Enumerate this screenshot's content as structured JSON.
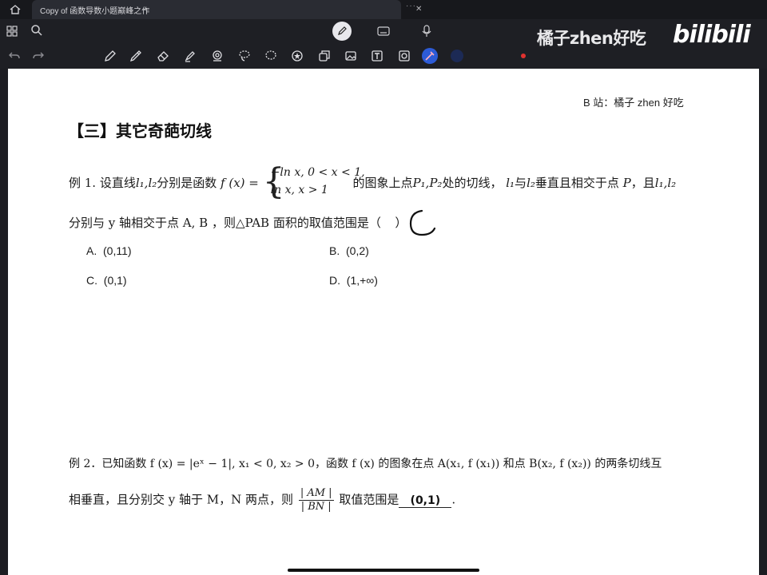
{
  "tab": {
    "title": "Copy of 函数导数小题巅峰之作"
  },
  "watermark": {
    "text": "橘子zhen好吃",
    "logo": "bilibili"
  },
  "toolbar": {
    "tools": [
      "pen-icon",
      "pencil-icon",
      "eraser-icon",
      "highlighter-icon",
      "shape-icon",
      "lasso-icon",
      "lasso-select-icon",
      "sticker-icon",
      "copy-icon",
      "image-icon",
      "text-icon",
      "camera-icon",
      "laser-icon"
    ],
    "colors": {
      "blue": "#2d5bd6",
      "dark": "#1c2a55",
      "red": "#e0322f"
    }
  },
  "page": {
    "credit": "B 站：橘子 zhen 好吃",
    "section_title": "【三】其它奇葩切线",
    "q1": {
      "line1_prefix": "例 1. 设直线",
      "line1_l": "l₁,l₂",
      "line1_mid": "分别是函数",
      "line1_fx": "f (x) =",
      "piece1": "−ln x, 0 < x < 1,",
      "piece2": "ln x, x > 1",
      "line1_after": "的图象上点",
      "points": "P₁,P₂",
      "line1_tail": "处的切线，",
      "l1": "l₁",
      "yu": "与",
      "l2": "l₂",
      "line1_end": "垂直且相交于点",
      "P": "P",
      "comma_and": "，且",
      "l1l2": "l₁,l₂",
      "line2": "分别与 y 轴相交于点 A,  B ，则△PAB 面积的取值范围是（",
      "line2_close": "）",
      "choices": [
        {
          "letter": "A.",
          "text": "(0,11)"
        },
        {
          "letter": "B.",
          "text": "(0,2)"
        },
        {
          "letter": "C.",
          "text": "(0,1)"
        },
        {
          "letter": "D.",
          "text": "(1,+∞)"
        }
      ]
    },
    "q2": {
      "line1": "例 2．已知函数 f (x) = |eˣ − 1|, x₁ < 0, x₂ > 0，函数 f (x) 的图象在点 A(x₁, f (x₁)) 和点 B(x₂, f (x₂)) 的两条切线互",
      "line2_prefix": "相垂直，且分别交 y 轴于 M，N 两点，则",
      "frac_num": "| AM |",
      "frac_den": "| BN |",
      "line2_suffix": "取值范围是",
      "answer": "(0,1)",
      "end": "."
    }
  }
}
